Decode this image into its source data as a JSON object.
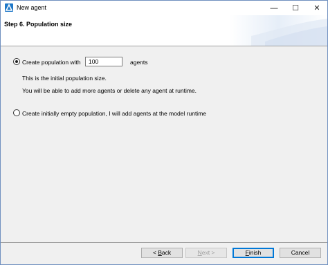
{
  "window": {
    "title": "New agent"
  },
  "header": {
    "step_title": "Step 6. Population size"
  },
  "options": {
    "create_population": {
      "label": "Create population with",
      "value": "100",
      "suffix": "agents",
      "selected": true,
      "note1": "This is the initial population size.",
      "note2": "You will be able to add more agents or delete any agent at runtime."
    },
    "empty_population": {
      "label": "Create initially empty population, I will add agents at the model runtime",
      "selected": false
    }
  },
  "buttons": {
    "back_prefix": "< ",
    "back_mnemonic": "B",
    "back_rest": "ack",
    "next_mnemonic": "N",
    "next_rest": "ext",
    "next_suffix": " >",
    "finish_mnemonic": "F",
    "finish_rest": "inish",
    "cancel": "Cancel"
  }
}
